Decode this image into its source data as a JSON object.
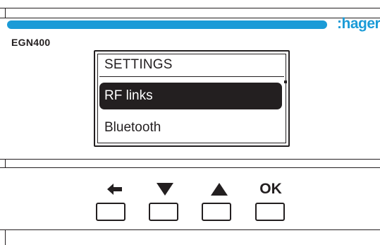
{
  "colors": {
    "brand_blue": "#1b9bd7",
    "ink": "#231f20",
    "background": "#ffffff"
  },
  "brand": {
    "name": ":hager"
  },
  "device": {
    "model": "EGN400"
  },
  "screen": {
    "title": "SETTINGS",
    "menu_items": [
      {
        "label": "RF links",
        "selected": true
      },
      {
        "label": "Bluetooth",
        "selected": false
      }
    ]
  },
  "keypad": [
    {
      "name": "back",
      "icon": "arrow-left-icon",
      "label": ""
    },
    {
      "name": "down",
      "icon": "triangle-down-icon",
      "label": ""
    },
    {
      "name": "up",
      "icon": "triangle-up-icon",
      "label": ""
    },
    {
      "name": "ok",
      "icon": "",
      "label": "OK"
    }
  ]
}
